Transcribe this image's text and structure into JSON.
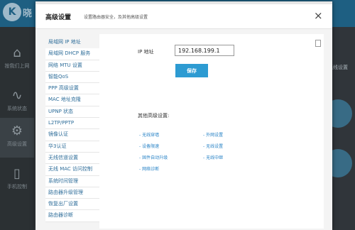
{
  "background": {
    "logo_glyph": "K",
    "logo_text": "晓",
    "nav": [
      {
        "icon": "home-icon",
        "glyph": "⌂",
        "label": "按我们上网"
      },
      {
        "icon": "pulse-icon",
        "glyph": "∿",
        "label": "系统状态"
      },
      {
        "icon": "gear-icon",
        "glyph": "⚙",
        "label": "高级设置"
      },
      {
        "icon": "phone-icon",
        "glyph": "▯",
        "label": "手机控制"
      }
    ],
    "right_label": "无线设置"
  },
  "modal": {
    "title": "高级设置",
    "subtitle": "设置路由器安全，及其他高级设置",
    "close_glyph": "×"
  },
  "menu": [
    "局域网 IP 地址",
    "局域网 DHCP 服务",
    "网络 MTU 设置",
    "智能QoS",
    "PPP 高级设置",
    "MAC 地址克隆",
    "UPNP 状态",
    "L2TP/PPTP",
    "镜像认证",
    "华3认证",
    "无线信道设置",
    "无线 MAC 访问控制",
    "系统时间管理",
    "路由器升级管理",
    "恢复出厂设置",
    "路由器诊断"
  ],
  "form": {
    "ip_label": "IP 地址",
    "ip_value": "192.168.199.1",
    "save_label": "保存"
  },
  "other": {
    "title": "其他高级设置:",
    "links": [
      "- 无线穿墙",
      "- 外网设置",
      "- 设备限速",
      "- 无线设置",
      "- 固件自动升级",
      "- 无线中继",
      "- 网络诊断"
    ]
  },
  "colors": {
    "accent": "#2d9bd2",
    "link": "#2a84c7",
    "topbar": "#1e5f82"
  }
}
